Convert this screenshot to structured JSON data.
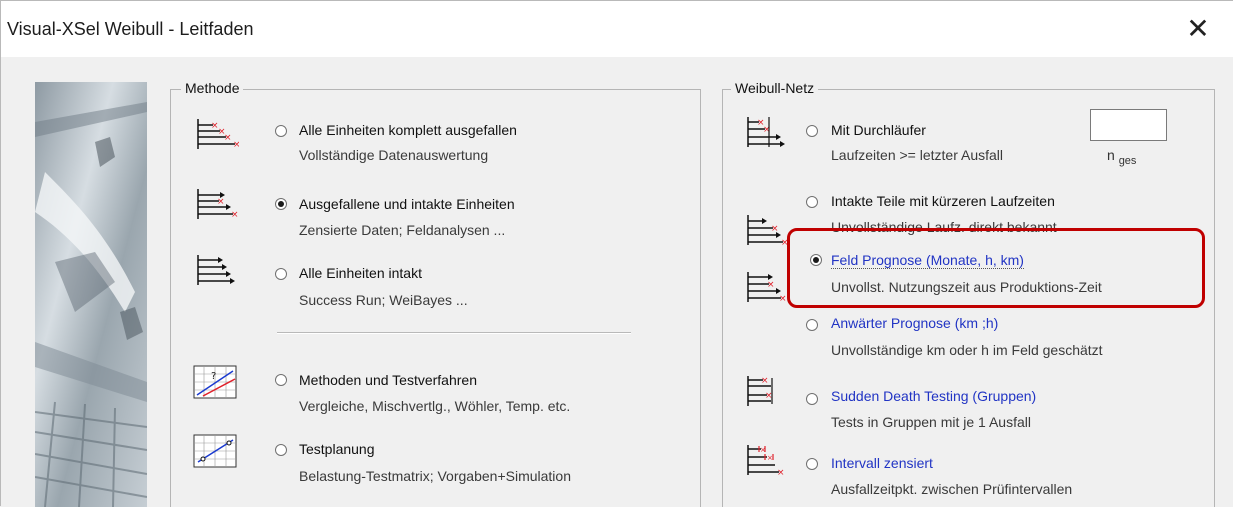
{
  "window": {
    "title": "Visual-XSel   Weibull - Leitfaden",
    "close_glyph": "✕"
  },
  "methode": {
    "legend": "Methode",
    "options": [
      {
        "label": "Alle Einheiten komplett ausgefallen",
        "sub": "Vollständige Datenauswertung",
        "selected": false,
        "icon": "all-failed-icon"
      },
      {
        "label": "Ausgefallene und intakte Einheiten",
        "sub": "Zensierte Daten; Feldanalysen ...",
        "selected": true,
        "icon": "censored-data-icon"
      },
      {
        "label": "Alle Einheiten intakt",
        "sub": "Success Run;  WeiBayes ...",
        "selected": false,
        "icon": "all-intact-icon"
      },
      {
        "label": "Methoden und Testverfahren",
        "sub": "Vergleiche, Mischvertlg., Wöhler, Temp. etc.",
        "selected": false,
        "icon": "methods-chart-icon"
      },
      {
        "label": "Testplanung",
        "sub": "Belastung-Testmatrix; Vorgaben+Simulation",
        "selected": false,
        "icon": "test-planning-chart-icon"
      }
    ]
  },
  "weibull_netz": {
    "legend": "Weibull-Netz",
    "n_ges": {
      "prefix": "n",
      "subscript": "ges",
      "value": ""
    },
    "options": [
      {
        "label": "Mit Durchläufer",
        "sub": "Laufzeiten >= letzter Ausfall",
        "selected": false,
        "icon": "runner-icon"
      },
      {
        "label": "Intakte Teile mit kürzeren Laufzeiten",
        "sub": "Unvollständige Laufz. direkt bekannt",
        "selected": false,
        "icon": "intact-shorter-icon"
      },
      {
        "label": "Feld Prognose (Monate, h, km)",
        "sub": "Unvollst. Nutzungszeit aus Produktions-Zeit",
        "selected": true,
        "icon": "field-forecast-icon"
      },
      {
        "label": "Anwärter Prognose (km ;h)",
        "sub": "Unvollständige km oder h im Feld geschätzt",
        "selected": false,
        "icon": ""
      },
      {
        "label": "Sudden Death Testing (Gruppen)",
        "sub": "Tests in Gruppen mit je 1 Ausfall",
        "selected": false,
        "icon": "sudden-death-icon"
      },
      {
        "label": "Intervall zensiert",
        "sub": "Ausfallzeitpkt. zwischen Prüfintervallen",
        "selected": false,
        "icon": "interval-censored-icon"
      }
    ]
  },
  "colors": {
    "highlight": "#c00000",
    "link_blue": "#2134c4",
    "icon_red": "#e0202a"
  }
}
